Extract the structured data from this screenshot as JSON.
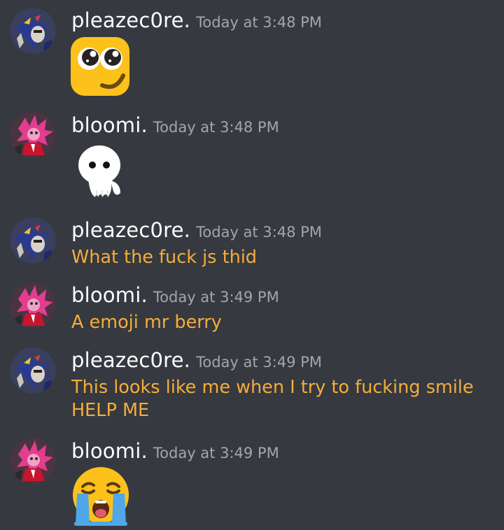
{
  "messages": [
    {
      "author": "pleazec0re.",
      "timestamp": "Today at 3:48 PM",
      "type": "emoji",
      "emoji": "pleading-smirk-emoji"
    },
    {
      "author": "bloomi.",
      "timestamp": "Today at 3:48 PM",
      "type": "emoji",
      "emoji": "ghost-character-emoji"
    },
    {
      "author": "pleazec0re.",
      "timestamp": "Today at 3:48 PM",
      "type": "text",
      "text": "What the fuck js thid"
    },
    {
      "author": "bloomi.",
      "timestamp": "Today at 3:49 PM",
      "type": "text",
      "text": "A emoji mr berry"
    },
    {
      "author": "pleazec0re.",
      "timestamp": "Today at 3:49 PM",
      "type": "text",
      "text": "This looks like me when I try to fucking smile\nHELP ME"
    },
    {
      "author": "bloomi.",
      "timestamp": "Today at 3:49 PM",
      "type": "emoji",
      "emoji": "loudly-crying-face-emoji"
    }
  ],
  "colors": {
    "background": "#36393f",
    "username": "#ffffff",
    "timestamp": "#a3a6aa",
    "message_text": "#f4ad3b"
  }
}
